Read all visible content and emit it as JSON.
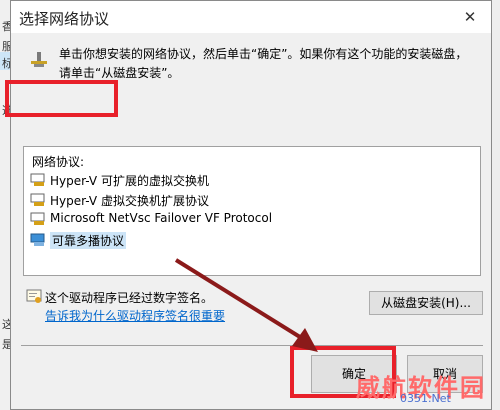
{
  "dialog": {
    "title": "选择网络协议",
    "close_glyph": "✕",
    "instruction": "单击你想安装的网络协议，然后单击“确定”。如果你有这个功能的安装磁盘，请单击“从磁盘安装”。",
    "list_header": "网络协议:",
    "protocols": [
      {
        "label": "Hyper-V 可扩展的虚拟交换机",
        "selected": false
      },
      {
        "label": "Hyper-V 虚拟交换机扩展协议",
        "selected": false
      },
      {
        "label": "Microsoft NetVsc Failover VF Protocol",
        "selected": false
      },
      {
        "label": "可靠多播协议",
        "selected": true
      }
    ],
    "signed_text": "这个驱动程序已经过数字签名。",
    "signed_link": "告诉我为什么驱动程序签名很重要",
    "from_disk_button": "从磁盘安装(H)...",
    "ok_button": "确定",
    "cancel_button": "取消"
  },
  "background_fragments": [
    "香",
    "服",
    "标",
    "选",
    "这",
    "是"
  ],
  "watermark": {
    "text": "威航软件园",
    "sub": "0351.Net"
  },
  "colors": {
    "highlight_box": "#e8202a",
    "arrow": "#8b1a1a",
    "link": "#0066cc",
    "selection": "#cce4f7"
  }
}
